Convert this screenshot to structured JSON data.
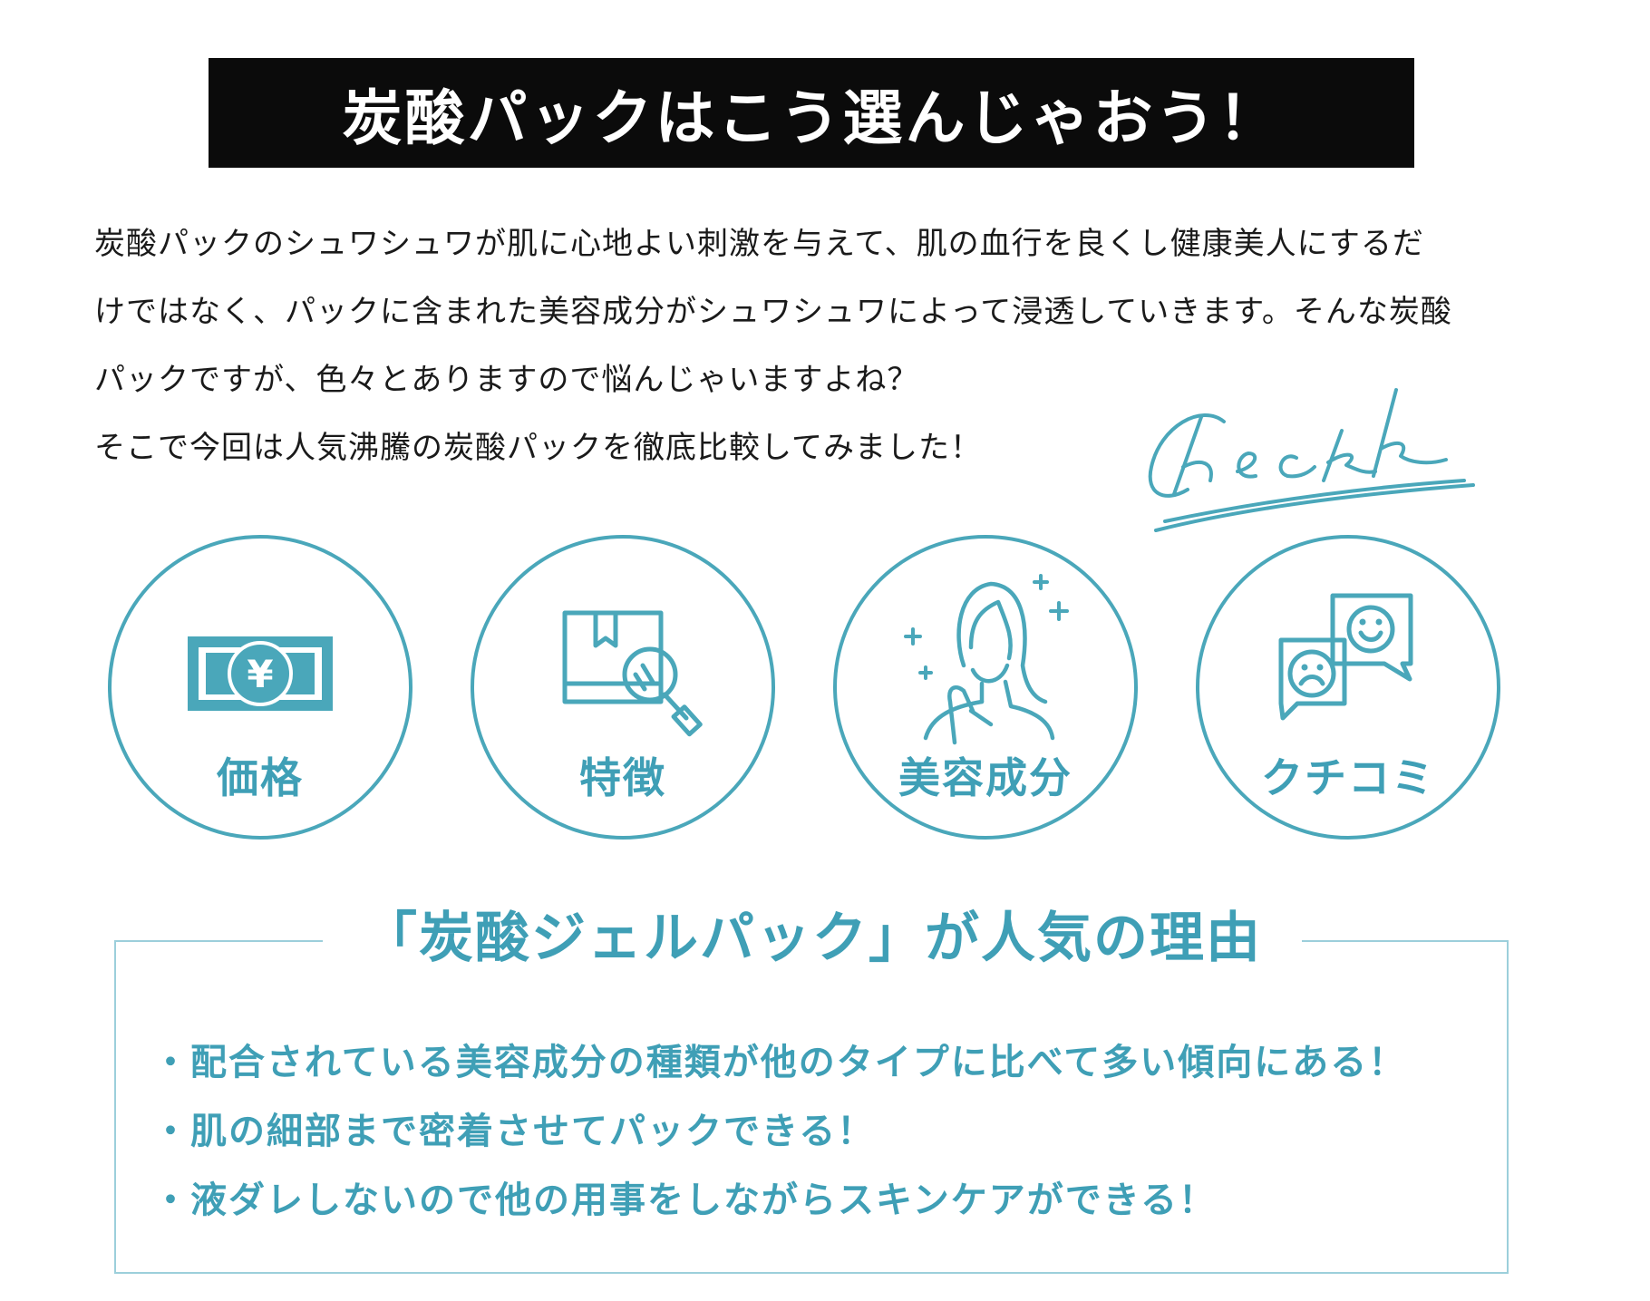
{
  "title": "炭酸パックはこう選んじゃおう！",
  "intro": {
    "lines": [
      "炭酸パックのシュワシュワが肌に心地よい刺激を与えて、肌の血行を良くし健康美人にするだ",
      "けではなく、パックに含まれた美容成分がシュワシュワによって浸透していきます。そんな炭酸",
      "パックですが、色々とありますので悩んじゃいますよね？",
      "そこで今回は人気沸騰の炭酸パックを徹底比較してみました！"
    ]
  },
  "check_logo": "Check",
  "criteria": [
    {
      "label": "価格",
      "icon": "yen-banknote-icon"
    },
    {
      "label": "特徴",
      "icon": "box-magnifier-icon"
    },
    {
      "label": "美容成分",
      "icon": "woman-sparkle-icon"
    },
    {
      "label": "クチコミ",
      "icon": "smile-frown-chat-icon"
    }
  ],
  "reasons": {
    "heading": "「炭酸ジェルパック」が人気の理由",
    "items": [
      "・配合されている美容成分の種類が他のタイプに比べて多い傾向にある！",
      "・肌の細部まで密着させてパックできる！",
      "・液ダレしないので他の用事をしながらスキンケアができる！"
    ]
  },
  "colors": {
    "accent": "#3f9fb6",
    "circle_border": "#4aa7ba",
    "box_border": "#9ccfdb",
    "title_bg": "#0b0b0b",
    "text": "#1a1a1a"
  }
}
